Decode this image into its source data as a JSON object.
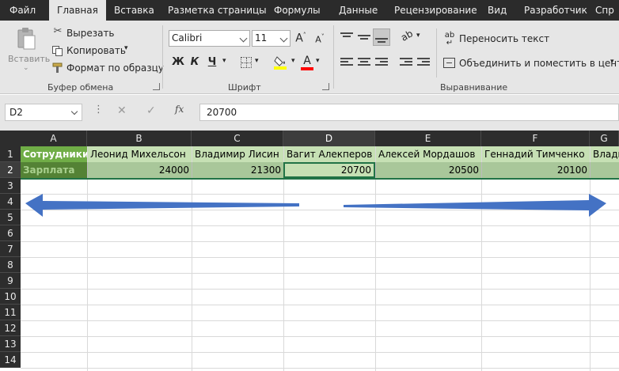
{
  "ribbon": {
    "tabs": [
      "Файл",
      "Главная",
      "Вставка",
      "Разметка страницы",
      "Формулы",
      "Данные",
      "Рецензирование",
      "Вид",
      "Разработчик",
      "Спр"
    ],
    "active_tab": "Главная",
    "clipboard": {
      "paste_label": "Вставить",
      "cut_label": "Вырезать",
      "copy_label": "Копировать",
      "format_painter_label": "Формат по образцу",
      "group_label": "Буфер обмена"
    },
    "font": {
      "name": "Calibri",
      "size": "11",
      "bold": "Ж",
      "italic": "К",
      "underline": "Ч",
      "group_label": "Шрифт",
      "highlight_color": "#ffff00",
      "font_color": "#ff0000"
    },
    "alignment": {
      "wrap_label": "Переносить текст",
      "merge_label": "Объединить и поместить в центре",
      "group_label": "Выравнивание"
    }
  },
  "formula_bar": {
    "name_box": "D2",
    "fx": "fx",
    "value": "20700"
  },
  "sheet": {
    "columns": [
      "A",
      "B",
      "C",
      "D",
      "E",
      "F",
      "G"
    ],
    "selected_column": "D",
    "rows": [
      "1",
      "2",
      "3",
      "4",
      "5",
      "6",
      "7",
      "8",
      "9",
      "10",
      "11",
      "12",
      "13",
      "14"
    ],
    "selected_row": "2",
    "row1": [
      "Сотрудники",
      "Леонид Михельсон",
      "Владимир Лисин",
      "Вагит Алекперов",
      "Алексей Мордашов",
      "Геннадий Тимченко",
      "Влади"
    ],
    "row2": [
      "Зарплата",
      "24000",
      "21300",
      "20700",
      "20500",
      "20100",
      ""
    ],
    "header_fill": "#70ad47",
    "name_fill": "#c6e0b4",
    "label_fill": "#548235",
    "value_fill": "#a9c79a",
    "arrow_color": "#4472c4"
  }
}
